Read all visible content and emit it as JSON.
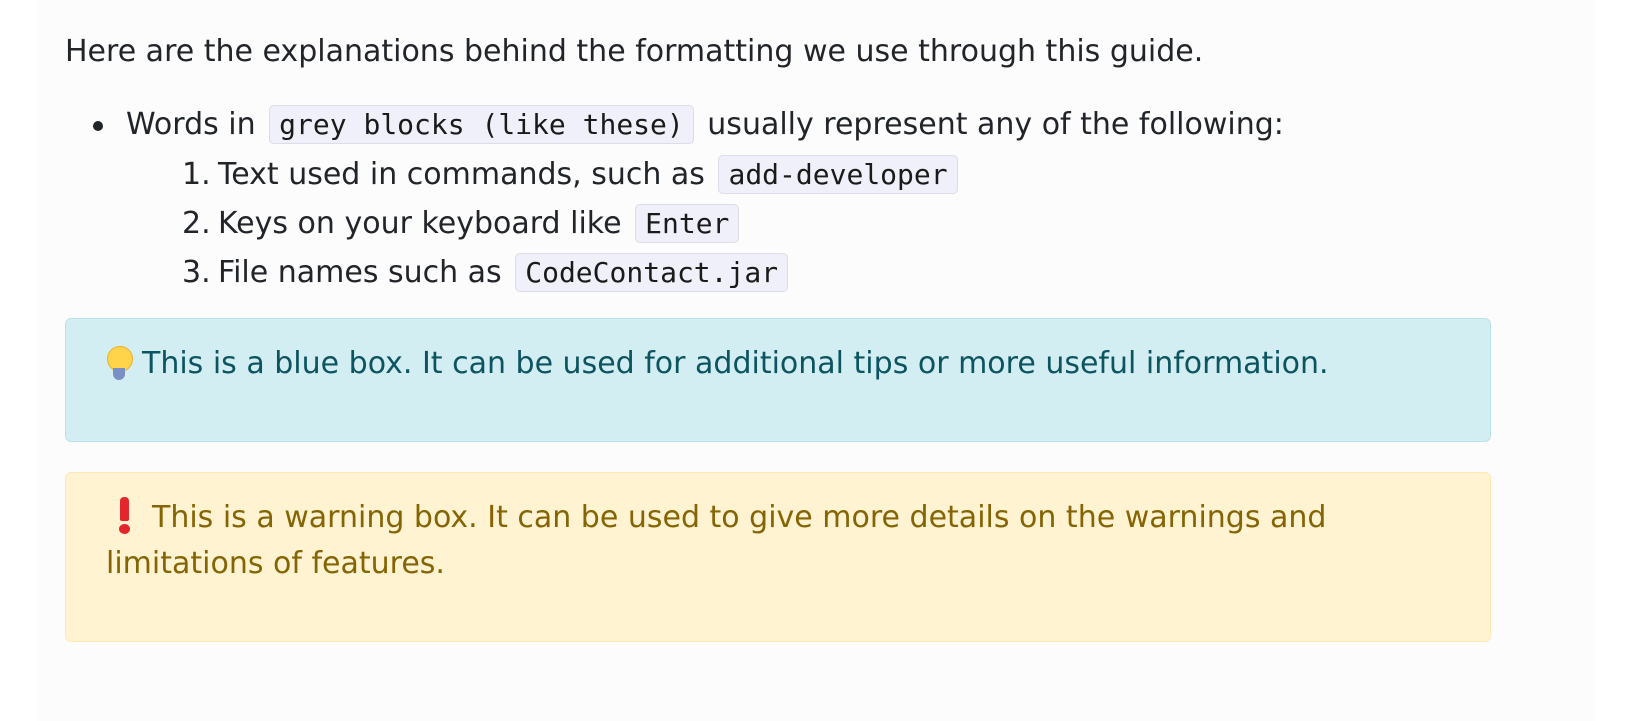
{
  "intro": "Here are the explanations behind the formatting we use through this guide.",
  "bullet": {
    "prefix": "Words in",
    "code": "grey blocks (like these)",
    "suffix": "usually represent any of the following:"
  },
  "subitems": [
    {
      "num": "1.",
      "text": "Text used in commands, such as",
      "code": "add-developer"
    },
    {
      "num": "2.",
      "text": "Keys on your keyboard like",
      "code": "Enter"
    },
    {
      "num": "3.",
      "text": "File names such as",
      "code": "CodeContact.jar"
    }
  ],
  "tip_box": {
    "icon": "lightbulb-icon",
    "text": "This is a blue box. It can be used for additional tips or more useful information."
  },
  "warning_box": {
    "icon": "exclamation-icon",
    "text": "This is a warning box. It can be used to give more details on the warnings and limitations of features."
  },
  "colors": {
    "tip_bg": "#d3eef2",
    "tip_text": "#0c5460",
    "warning_bg": "#fff3d2",
    "warning_text": "#856404",
    "code_bg": "#eff0fa"
  }
}
